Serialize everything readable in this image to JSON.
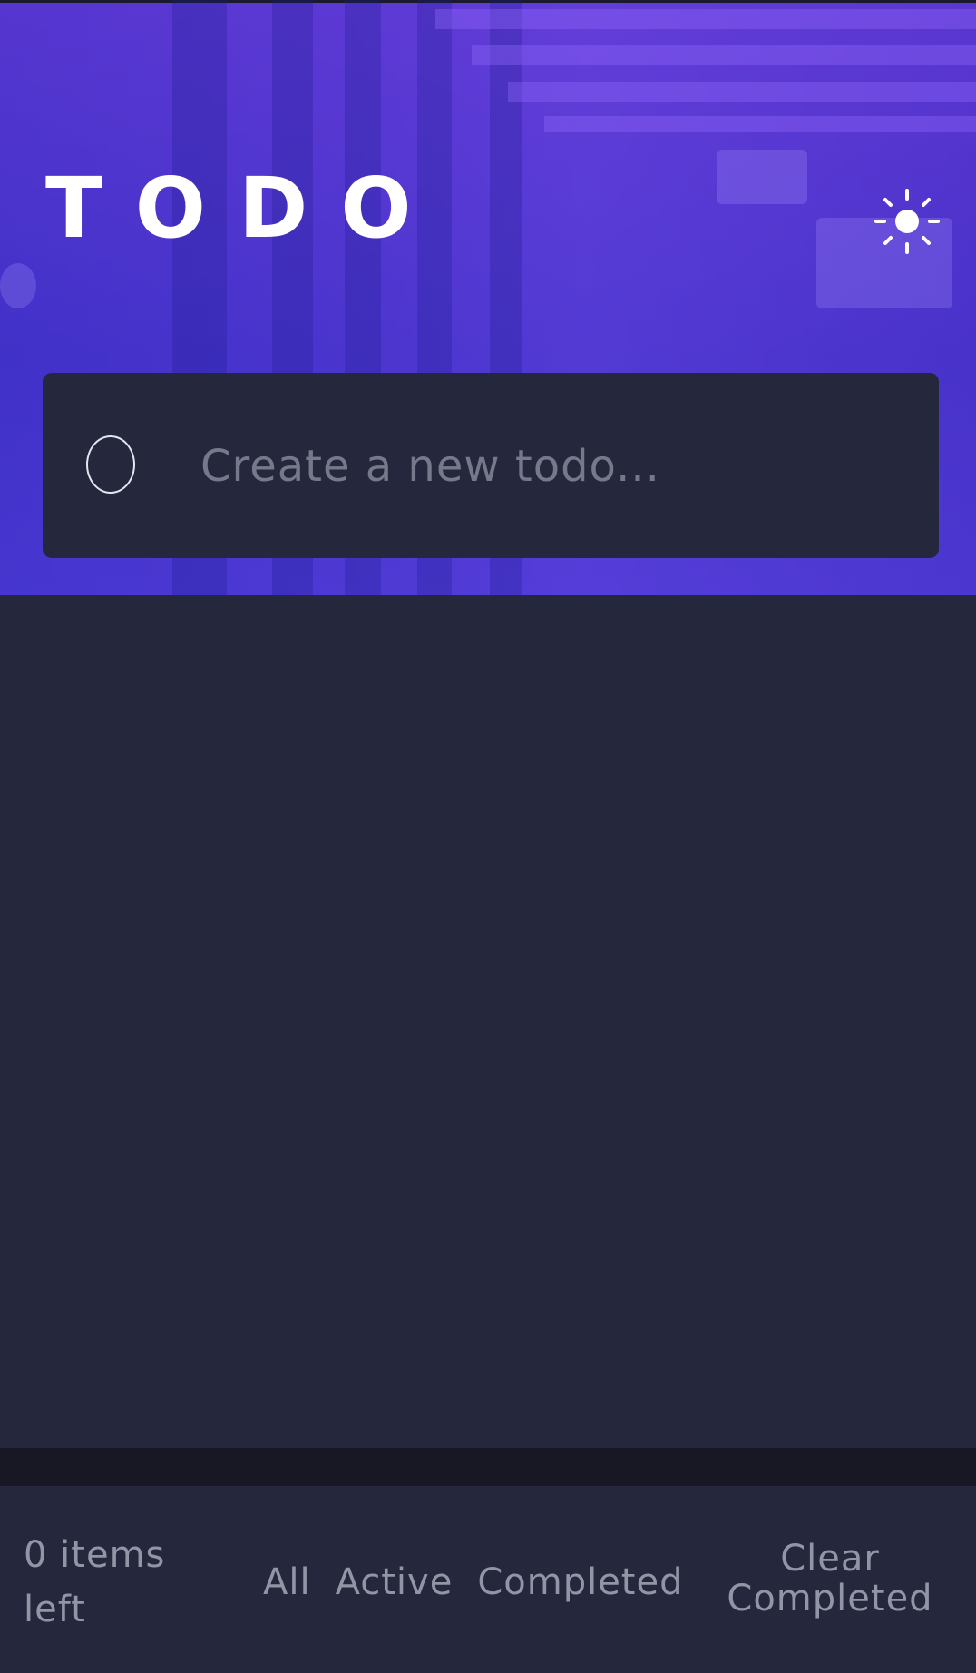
{
  "header": {
    "title": "TODO",
    "theme_toggle_icon": "sun-icon"
  },
  "new_todo": {
    "placeholder": "Create a new todo...",
    "value": ""
  },
  "todos": [],
  "footer": {
    "items_left": "0 items left",
    "filters": [
      {
        "label": "All"
      },
      {
        "label": "Active"
      },
      {
        "label": "Completed"
      }
    ],
    "clear_label": "Clear Completed"
  },
  "colors": {
    "background": "#25273c",
    "hero_gradient_start": "#3a2fc0",
    "hero_gradient_end": "#5a3fd4",
    "text_muted": "#9394a5",
    "title": "#ffffff"
  }
}
